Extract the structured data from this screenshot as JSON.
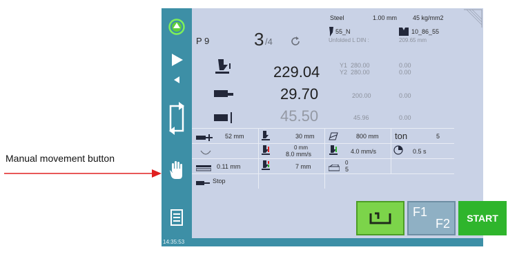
{
  "annotation": {
    "label": "Manual movement button"
  },
  "status": {
    "clock": "14:35:53"
  },
  "program": {
    "name": "P 9",
    "step": "3",
    "step_total": "/4"
  },
  "material": {
    "name": "Steel",
    "thickness": "1.00 mm",
    "strength": "45 kg/mm2",
    "punch": "55_N",
    "die": "10_86_55",
    "unfolded_label": "Unfolded  L  DIN :",
    "unfolded_value": "209.65 mm"
  },
  "axes": {
    "y_value": "229.04",
    "x_value": "29.70",
    "r_value": "45.50",
    "y1_label": "Y1",
    "y1_value": "280.00",
    "y1_corr": "0.00",
    "y2_label": "Y2",
    "y2_value": "280.00",
    "y2_corr": "0.00",
    "x_aux": "200.00",
    "x_corr": "0.00",
    "r_aux": "45.96",
    "r_corr": "0.00"
  },
  "params": {
    "flange": "52 mm",
    "opening": "30 mm",
    "length": "800 mm",
    "ton_label": "ton",
    "ton_value": "5",
    "speed_label": "0 mm",
    "speed_value": "8.0 mm/s",
    "bend_speed": "4.0 mm/s",
    "dwell": "0.5 s",
    "crowning": "0.11 mm",
    "decompression": "7 mm",
    "count_top": "0",
    "count_bottom": "5",
    "stop": "Stop"
  },
  "buttons": {
    "f1": "F1",
    "f2": "F2",
    "start": "START"
  },
  "icons": {
    "status": "green-circle-icon",
    "play": "play-icon",
    "back": "back-arrow-icon",
    "cycle": "cycle-icon",
    "hand": "hand-icon",
    "list": "list-icon",
    "refresh": "refresh-icon"
  },
  "colors": {
    "accent": "#3d8fa6",
    "screen": "#c9d2e6",
    "start": "#2fb52c",
    "fold": "#7cd44a",
    "arrow": "#e02020"
  }
}
